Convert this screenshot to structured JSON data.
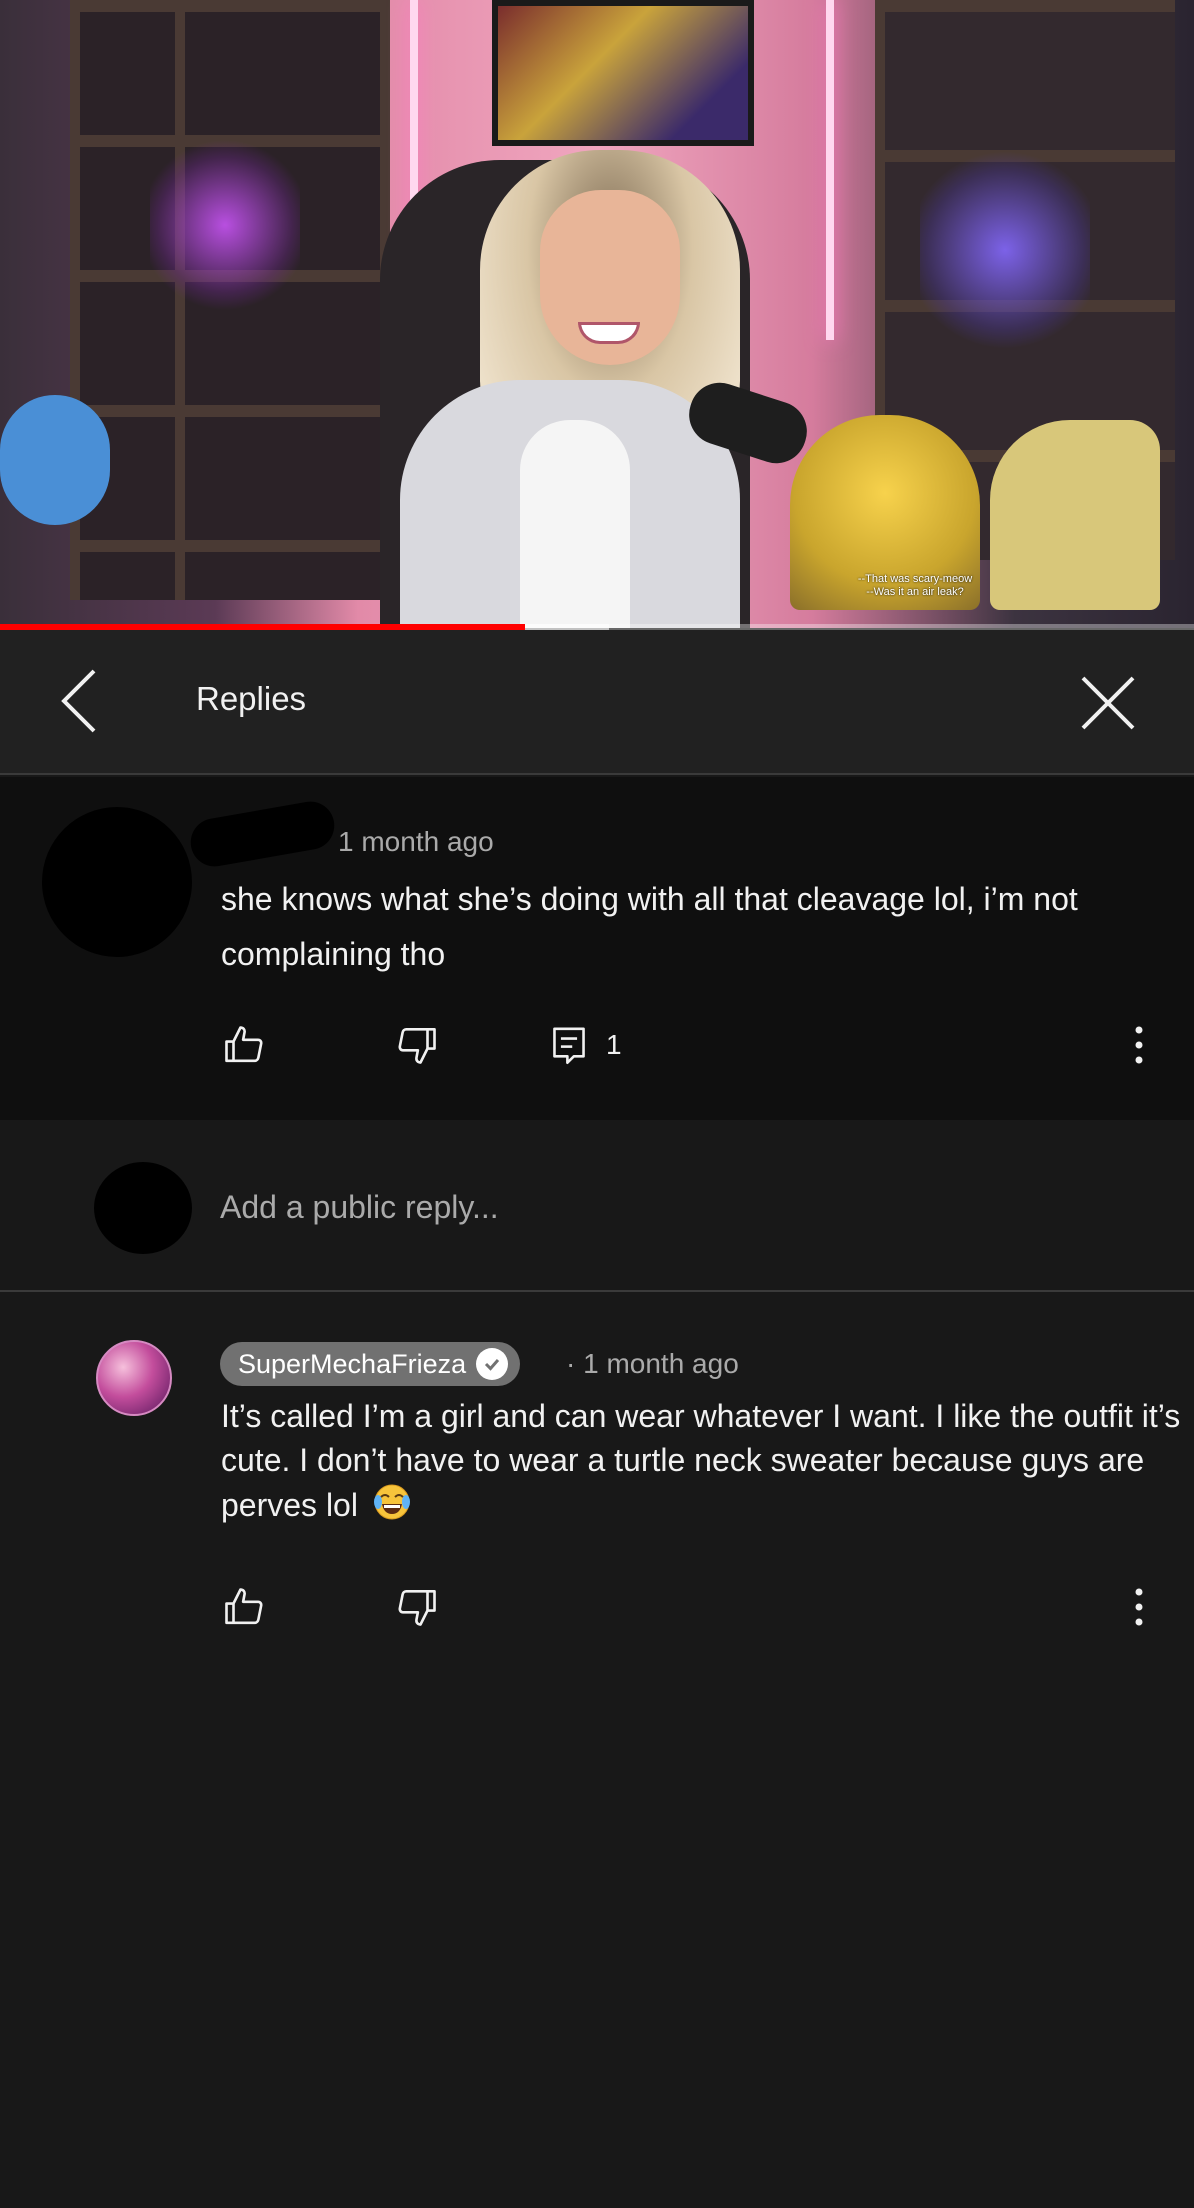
{
  "video": {
    "subtitle_line1": "--That was scary-meow",
    "subtitle_line2": "--Was it an air leak?",
    "progress": 0.44,
    "buffered": 0.51
  },
  "header": {
    "title": "Replies",
    "back_icon": "chevron-left-icon",
    "close_icon": "close-icon"
  },
  "parent_comment": {
    "timestamp": "1 month ago",
    "text": "she knows what she’s doing with all that cleavage lol, i’m not complaining tho",
    "reply_count": "1"
  },
  "add_reply": {
    "placeholder": "Add a public reply..."
  },
  "reply_comment": {
    "author": "SuperMechaFrieza",
    "timestamp": "1 month ago",
    "separator": "·",
    "text": "It’s called I’m a girl and can wear whatever I want.  I like the outfit it’s cute.  I don’t have to wear a turtle neck sweater because guys are perves lol",
    "emoji": "tears-of-joy-emoji"
  },
  "colors": {
    "background": "#181818",
    "parent_background": "#0f0f0f",
    "header_background": "#212121",
    "progress": "#ff0000",
    "secondary_text": "#aaaaaa",
    "chip": "#717171"
  }
}
